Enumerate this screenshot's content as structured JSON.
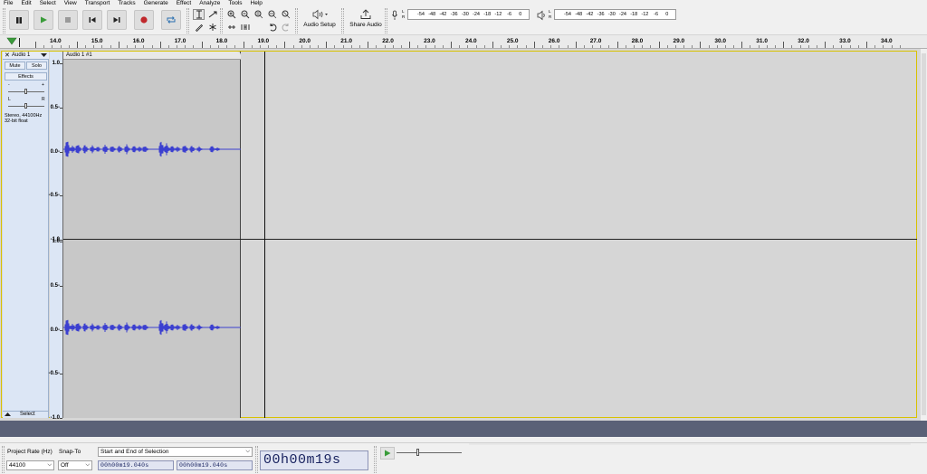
{
  "menu": [
    "File",
    "Edit",
    "Select",
    "View",
    "Transport",
    "Tracks",
    "Generate",
    "Effect",
    "Analyze",
    "Tools",
    "Help"
  ],
  "toolbar": {
    "audio_setup_label": "Audio Setup",
    "share_audio_label": "Share Audio",
    "record_meter": {
      "channels": [
        "L",
        "R"
      ],
      "ticks": [
        "-54",
        "-48",
        "-42",
        "-36",
        "-30",
        "-24",
        "-18",
        "-12",
        "-6",
        "0"
      ]
    },
    "play_meter": {
      "channels": [
        "L",
        "R"
      ],
      "ticks": [
        "-54",
        "-48",
        "-42",
        "-36",
        "-30",
        "-24",
        "-18",
        "-12",
        "-6",
        "0"
      ]
    },
    "colors": {
      "play": "#3a9c3a",
      "record": "#c0282c",
      "transport_icon": "#2a2a2a"
    }
  },
  "ruler": {
    "ticks": [
      "14.0",
      "15.0",
      "16.0",
      "17.0",
      "18.0",
      "19.0",
      "20.0",
      "21.0",
      "22.0",
      "23.0",
      "24.0",
      "25.0",
      "26.0",
      "27.0",
      "28.0",
      "29.0",
      "30.0",
      "31.0",
      "32.0",
      "33.0",
      "34.0"
    ]
  },
  "track": {
    "name": "Audio 1",
    "mute_label": "Mute",
    "solo_label": "Solo",
    "effects_label": "Effects",
    "gain_minus": "-",
    "gain_plus": "+",
    "pan_left": "L",
    "pan_right": "R",
    "info_line1": "Stereo, 44100Hz",
    "info_line2": "32-bit float",
    "select_label": "Select",
    "clip_name": "Audio 1 #1",
    "scale_labels": [
      "1.0",
      "0.5-",
      "0.0-",
      "-0.5-",
      "-1.0"
    ],
    "waveform_color": "#3b3fd0"
  },
  "bottom": {
    "project_rate_label": "Project Rate (Hz)",
    "project_rate_value": "44100",
    "snap_to_label": "Snap-To",
    "snap_to_value": "Off",
    "selection_mode": "Start and End of Selection",
    "selection_start": "00h00m19.040s",
    "selection_end": "00h00m19.040s",
    "position": "00h00m19s"
  }
}
